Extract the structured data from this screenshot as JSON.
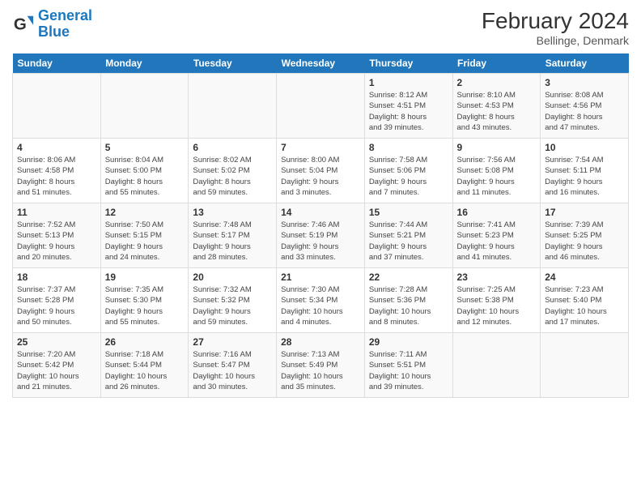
{
  "header": {
    "logo_line1": "General",
    "logo_line2": "Blue",
    "title": "February 2024",
    "subtitle": "Bellinge, Denmark"
  },
  "days_of_week": [
    "Sunday",
    "Monday",
    "Tuesday",
    "Wednesday",
    "Thursday",
    "Friday",
    "Saturday"
  ],
  "weeks": [
    [
      {
        "day": "",
        "info": ""
      },
      {
        "day": "",
        "info": ""
      },
      {
        "day": "",
        "info": ""
      },
      {
        "day": "",
        "info": ""
      },
      {
        "day": "1",
        "info": "Sunrise: 8:12 AM\nSunset: 4:51 PM\nDaylight: 8 hours\nand 39 minutes."
      },
      {
        "day": "2",
        "info": "Sunrise: 8:10 AM\nSunset: 4:53 PM\nDaylight: 8 hours\nand 43 minutes."
      },
      {
        "day": "3",
        "info": "Sunrise: 8:08 AM\nSunset: 4:56 PM\nDaylight: 8 hours\nand 47 minutes."
      }
    ],
    [
      {
        "day": "4",
        "info": "Sunrise: 8:06 AM\nSunset: 4:58 PM\nDaylight: 8 hours\nand 51 minutes."
      },
      {
        "day": "5",
        "info": "Sunrise: 8:04 AM\nSunset: 5:00 PM\nDaylight: 8 hours\nand 55 minutes."
      },
      {
        "day": "6",
        "info": "Sunrise: 8:02 AM\nSunset: 5:02 PM\nDaylight: 8 hours\nand 59 minutes."
      },
      {
        "day": "7",
        "info": "Sunrise: 8:00 AM\nSunset: 5:04 PM\nDaylight: 9 hours\nand 3 minutes."
      },
      {
        "day": "8",
        "info": "Sunrise: 7:58 AM\nSunset: 5:06 PM\nDaylight: 9 hours\nand 7 minutes."
      },
      {
        "day": "9",
        "info": "Sunrise: 7:56 AM\nSunset: 5:08 PM\nDaylight: 9 hours\nand 11 minutes."
      },
      {
        "day": "10",
        "info": "Sunrise: 7:54 AM\nSunset: 5:11 PM\nDaylight: 9 hours\nand 16 minutes."
      }
    ],
    [
      {
        "day": "11",
        "info": "Sunrise: 7:52 AM\nSunset: 5:13 PM\nDaylight: 9 hours\nand 20 minutes."
      },
      {
        "day": "12",
        "info": "Sunrise: 7:50 AM\nSunset: 5:15 PM\nDaylight: 9 hours\nand 24 minutes."
      },
      {
        "day": "13",
        "info": "Sunrise: 7:48 AM\nSunset: 5:17 PM\nDaylight: 9 hours\nand 28 minutes."
      },
      {
        "day": "14",
        "info": "Sunrise: 7:46 AM\nSunset: 5:19 PM\nDaylight: 9 hours\nand 33 minutes."
      },
      {
        "day": "15",
        "info": "Sunrise: 7:44 AM\nSunset: 5:21 PM\nDaylight: 9 hours\nand 37 minutes."
      },
      {
        "day": "16",
        "info": "Sunrise: 7:41 AM\nSunset: 5:23 PM\nDaylight: 9 hours\nand 41 minutes."
      },
      {
        "day": "17",
        "info": "Sunrise: 7:39 AM\nSunset: 5:25 PM\nDaylight: 9 hours\nand 46 minutes."
      }
    ],
    [
      {
        "day": "18",
        "info": "Sunrise: 7:37 AM\nSunset: 5:28 PM\nDaylight: 9 hours\nand 50 minutes."
      },
      {
        "day": "19",
        "info": "Sunrise: 7:35 AM\nSunset: 5:30 PM\nDaylight: 9 hours\nand 55 minutes."
      },
      {
        "day": "20",
        "info": "Sunrise: 7:32 AM\nSunset: 5:32 PM\nDaylight: 9 hours\nand 59 minutes."
      },
      {
        "day": "21",
        "info": "Sunrise: 7:30 AM\nSunset: 5:34 PM\nDaylight: 10 hours\nand 4 minutes."
      },
      {
        "day": "22",
        "info": "Sunrise: 7:28 AM\nSunset: 5:36 PM\nDaylight: 10 hours\nand 8 minutes."
      },
      {
        "day": "23",
        "info": "Sunrise: 7:25 AM\nSunset: 5:38 PM\nDaylight: 10 hours\nand 12 minutes."
      },
      {
        "day": "24",
        "info": "Sunrise: 7:23 AM\nSunset: 5:40 PM\nDaylight: 10 hours\nand 17 minutes."
      }
    ],
    [
      {
        "day": "25",
        "info": "Sunrise: 7:20 AM\nSunset: 5:42 PM\nDaylight: 10 hours\nand 21 minutes."
      },
      {
        "day": "26",
        "info": "Sunrise: 7:18 AM\nSunset: 5:44 PM\nDaylight: 10 hours\nand 26 minutes."
      },
      {
        "day": "27",
        "info": "Sunrise: 7:16 AM\nSunset: 5:47 PM\nDaylight: 10 hours\nand 30 minutes."
      },
      {
        "day": "28",
        "info": "Sunrise: 7:13 AM\nSunset: 5:49 PM\nDaylight: 10 hours\nand 35 minutes."
      },
      {
        "day": "29",
        "info": "Sunrise: 7:11 AM\nSunset: 5:51 PM\nDaylight: 10 hours\nand 39 minutes."
      },
      {
        "day": "",
        "info": ""
      },
      {
        "day": "",
        "info": ""
      }
    ]
  ]
}
